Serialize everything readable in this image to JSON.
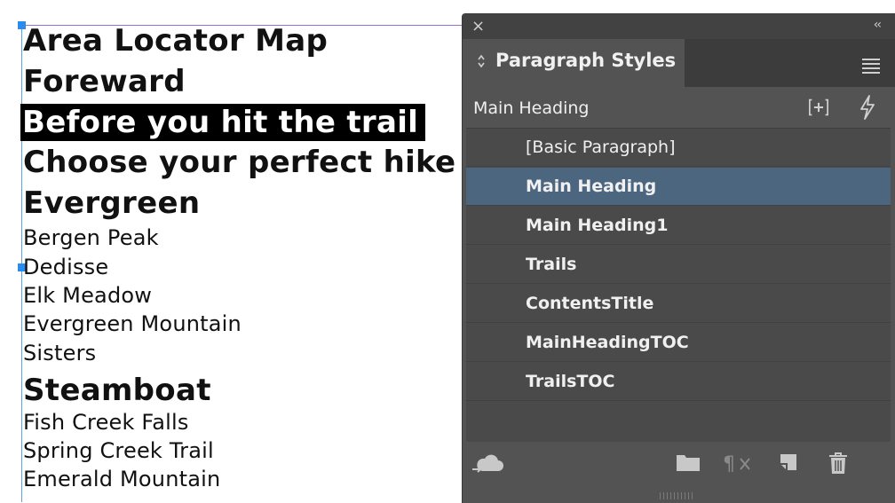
{
  "document": {
    "lines": [
      {
        "text": "Area Locator Map",
        "style": "heading"
      },
      {
        "text": "Foreward",
        "style": "heading"
      },
      {
        "text": "Before you hit the trail",
        "style": "heading-selected"
      },
      {
        "text": "Choose your perfect hike",
        "style": "heading"
      },
      {
        "text": "Evergreen",
        "style": "heading"
      },
      {
        "text": "Bergen Peak",
        "style": "trail"
      },
      {
        "text": "Dedisse",
        "style": "trail"
      },
      {
        "text": "Elk Meadow",
        "style": "trail"
      },
      {
        "text": "Evergreen Mountain",
        "style": "trail"
      },
      {
        "text": "Sisters",
        "style": "trail"
      },
      {
        "text": "Steamboat",
        "style": "heading"
      },
      {
        "text": "Fish Creek Falls",
        "style": "trail"
      },
      {
        "text": "Spring Creek Trail",
        "style": "trail"
      },
      {
        "text": "Emerald Mountain",
        "style": "trail"
      }
    ]
  },
  "panel": {
    "close_icon": "×",
    "collapse_icon": "‹‹",
    "tab_label": "Paragraph Styles",
    "tab_updown_icon": "⌃⌄",
    "current_style": "Main Heading",
    "styles": [
      {
        "label": "[Basic Paragraph]",
        "selected": false
      },
      {
        "label": "Main Heading",
        "selected": true
      },
      {
        "label": "Main Heading1",
        "selected": false
      },
      {
        "label": "Trails",
        "selected": false
      },
      {
        "label": "ContentsTitle",
        "selected": false
      },
      {
        "label": "MainHeadingTOC",
        "selected": false
      },
      {
        "label": "TrailsTOC",
        "selected": false
      }
    ],
    "colors": {
      "panel_bg": "#535353",
      "selected_row": "#4d6680",
      "selection_highlight": "#000000"
    }
  }
}
